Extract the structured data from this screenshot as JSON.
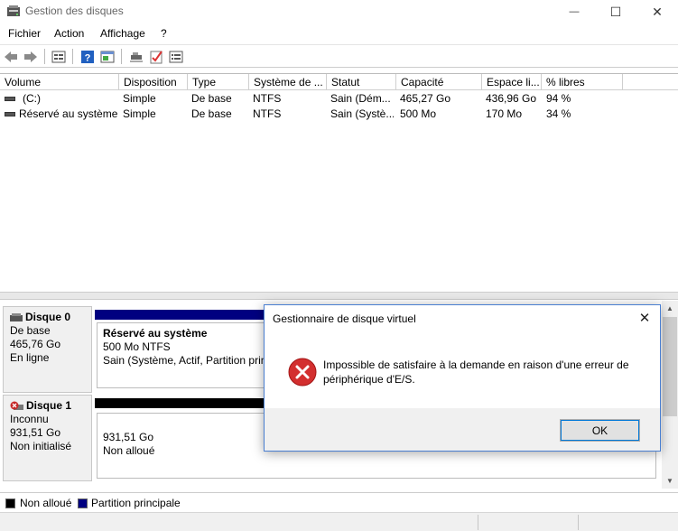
{
  "window": {
    "title": "Gestion des disques",
    "minimize_glyph": "—",
    "maximize_glyph": "☐",
    "close_glyph": "✕"
  },
  "menu": [
    {
      "label": "Fichier"
    },
    {
      "label": "Action"
    },
    {
      "label": "Affichage"
    },
    {
      "label": "?"
    }
  ],
  "toolbar": {
    "icons": [
      "back-icon",
      "forward-icon",
      "list-view-icon",
      "help-icon",
      "properties-icon",
      "connect-icon",
      "check-icon",
      "console-icon"
    ]
  },
  "volumes": {
    "columns": [
      "Volume",
      "Disposition",
      "Type",
      "Système de ...",
      "Statut",
      "Capacité",
      "Espace li...",
      "% libres"
    ],
    "rows": [
      [
        "(C:)",
        "Simple",
        "De base",
        "NTFS",
        "Sain (Dém...",
        "465,27 Go",
        "436,96 Go",
        "94 %"
      ],
      [
        "Réservé au système",
        "Simple",
        "De base",
        "NTFS",
        "Sain (Systè...",
        "500 Mo",
        "170 Mo",
        "34 %"
      ]
    ]
  },
  "disks": [
    {
      "name": "Disque 0",
      "type": "De base",
      "size": "465,76 Go",
      "state": "En ligne",
      "partition": {
        "title": "Réservé au système",
        "line1": "500 Mo NTFS",
        "line2": "Sain (Système, Actif, Partition principale)"
      }
    },
    {
      "name": "Disque 1",
      "type": "Inconnu",
      "size": "931,51 Go",
      "state": "Non initialisé",
      "partition": {
        "line1": "931,51 Go",
        "line2": "Non alloué"
      }
    }
  ],
  "legend": {
    "items": [
      {
        "label": "Non alloué",
        "color": "#000000"
      },
      {
        "label": "Partition principale",
        "color": "#000080"
      }
    ]
  },
  "dialog": {
    "title": "Gestionnaire de disque virtuel",
    "message": "Impossible de satisfaire à la demande en raison d'une erreur de périphérique d'E/S.",
    "ok_label": "OK",
    "icon": "error-icon"
  },
  "colors": {
    "primary_partition": "#000080",
    "unallocated": "#000000",
    "error_red": "#d32f2f",
    "accent": "#0078d7"
  }
}
